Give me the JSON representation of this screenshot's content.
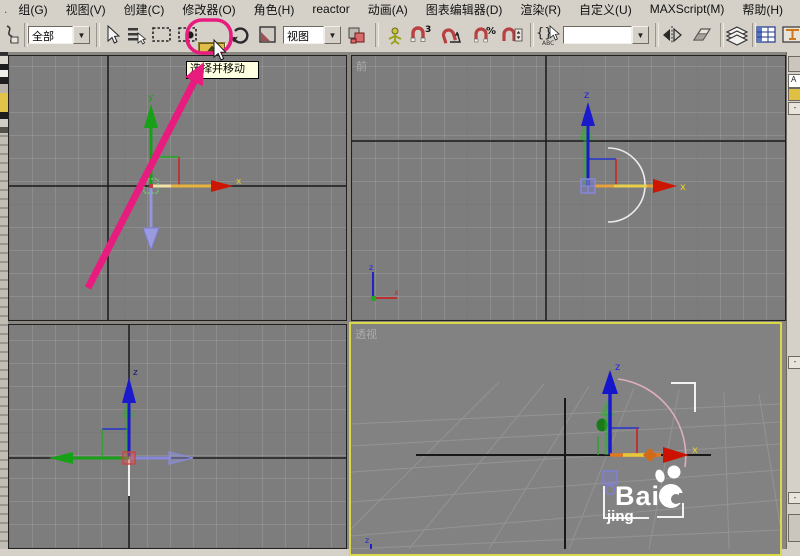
{
  "menu": {
    "lead": ".",
    "items": [
      "组(G)",
      "视图(V)",
      "创建(C)",
      "修改器(O)",
      "角色(H)",
      "reactor",
      "动画(A)",
      "图表编辑器(D)",
      "渲染(R)",
      "自定义(U)",
      "MAXScript(M)",
      "帮助(H)"
    ]
  },
  "toolbar": {
    "selection_filter_value": "全部",
    "coord_system_value": "视图",
    "named_sets_value": "",
    "dropdown_arrow": "▼",
    "snap3_superscript": "3",
    "percent_snap_label": "%",
    "kbd_override_label": "ABC",
    "tooltip_text": "选择并移动"
  },
  "viewports": {
    "top_left": {
      "axis_x": "x",
      "axis_y": "y"
    },
    "top_right": {
      "label": "前",
      "axis_x": "x",
      "axis_z": "z",
      "mini_axis_x": "x",
      "mini_axis_z": "z"
    },
    "bottom_left": {
      "axis_z": "z"
    },
    "bottom_right": {
      "label": "透视",
      "axis_x": "x",
      "axis_z": "z",
      "mini_axis_z": "z",
      "watermark_line1": "Bai",
      "watermark_line2": "jing"
    }
  },
  "panel": {
    "name_field_partial": "A",
    "rollout_collapse": "-"
  },
  "colors": {
    "chrome": "#d5d1c9",
    "viewport_bg": "#7d7d7d",
    "active_viewport_border": "#d8d84a",
    "annotation_magenta": "#e81b7e",
    "tooltip_bg": "#ffffe1",
    "highlight_tool_bg": "#e0bc4c",
    "axis_x_red": "#cc1600",
    "axis_y_green": "#18a018",
    "axis_z_blue": "#1a1acc"
  }
}
